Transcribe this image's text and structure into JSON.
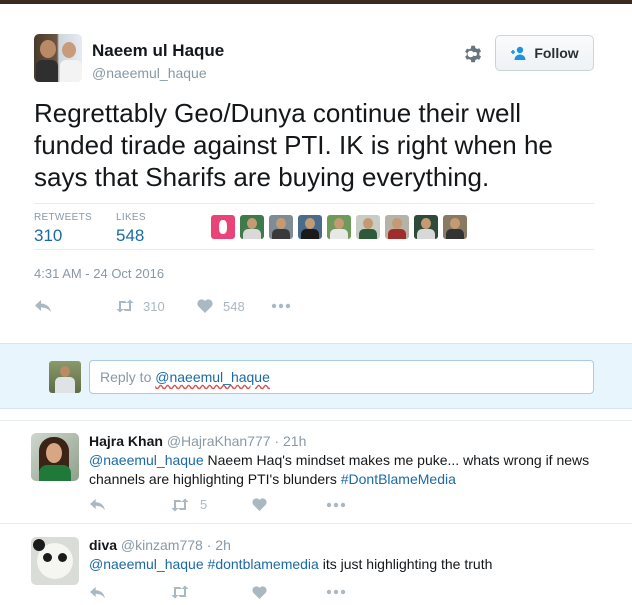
{
  "tweet": {
    "author_name": "Naeem ul Haque",
    "author_handle": "@naeemul_haque",
    "follow_label": "Follow",
    "text": "Regrettably Geo/Dunya continue their well funded tirade against PTI. IK is right when he says that Sharifs are buying everything.",
    "retweets_label": "RETWEETS",
    "retweets_count": "310",
    "likes_label": "LIKES",
    "likes_count": "548",
    "timestamp": "4:31 AM - 24 Oct 2016",
    "action_retweet_count": "310",
    "action_like_count": "548",
    "liker_avatar_count": 9
  },
  "reply_box": {
    "placeholder_prefix": "Reply to ",
    "placeholder_mention": "@naeemul_haque"
  },
  "replies": [
    {
      "name": "Hajra Khan",
      "handle": "@HajraKhan777",
      "time": "21h",
      "mention": "@naeemul_haque",
      "text": " Naeem Haq's mindset makes me puke... whats wrong if news channels are highlighting PTI's blunders ",
      "hashtag": "#DontBlameMedia",
      "retweet_count": "5"
    },
    {
      "name": "diva",
      "handle": "@kinzam778",
      "time": "2h",
      "mention": "@naeemul_haque",
      "hashtag": "#dontblamemedia",
      "text": " its just highlighting the truth"
    }
  ],
  "colors": {
    "link": "#1b6aa5",
    "muted": "#8899a6",
    "reply_bg": "#e8f5fd"
  }
}
